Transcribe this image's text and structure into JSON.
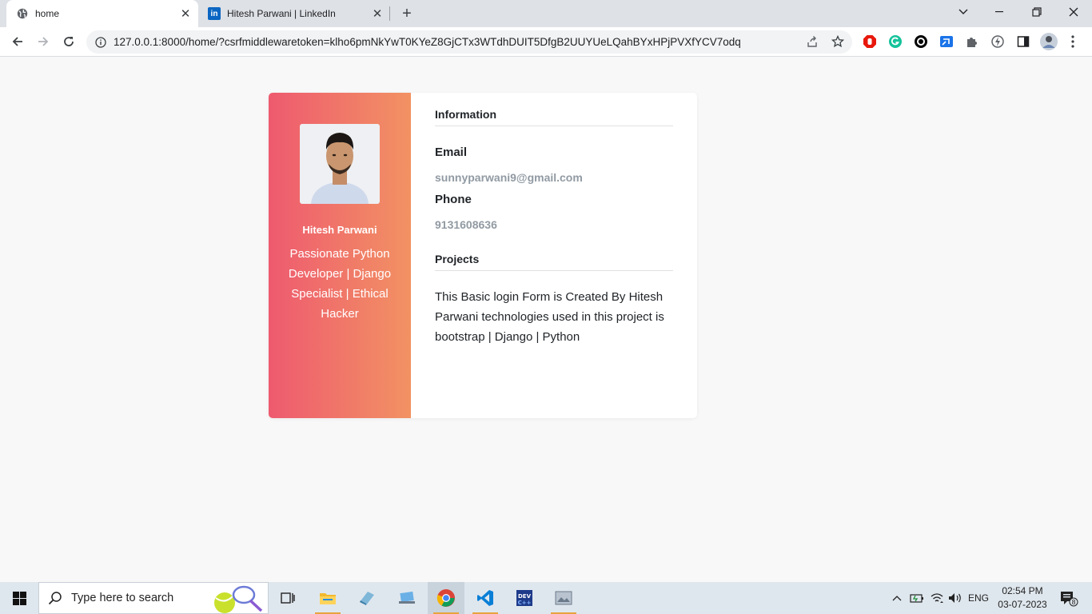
{
  "browser": {
    "tabs": [
      {
        "title": "home",
        "active": true,
        "icon": "globe-icon"
      },
      {
        "title": "Hitesh Parwani | LinkedIn",
        "active": false,
        "icon": "linkedin-icon"
      }
    ],
    "address": "127.0.0.1:8000/home/?csrfmiddlewaretoken=klho6pmNkYwT0KYeZ8GjCTx3WTdhDUIT5DfgB2UUYUeLQahBYxHPjPVXfYCV7odq",
    "extension_icons": [
      "adblock-icon",
      "grammarly-icon",
      "circle-extension-icon",
      "cast-extension-icon",
      "extensions-puzzle-icon",
      "performance-icon",
      "side-panel-icon",
      "profile-avatar"
    ]
  },
  "profile": {
    "name": "Hitesh Parwani",
    "bio": "Passionate Python Developer | Django Specialist | Ethical Hacker",
    "gradient_start": "#ee5a6f",
    "gradient_end": "#f29263"
  },
  "info": {
    "section_title": "Information",
    "email_label": "Email",
    "email": "sunnyparwani9@gmail.com",
    "phone_label": "Phone",
    "phone": "9131608636"
  },
  "projects": {
    "section_title": "Projects",
    "description": "This Basic login Form is Created By Hitesh Parwani technologies used in this project is bootstrap | Django | Python"
  },
  "taskbar": {
    "search_placeholder": "Type here to search",
    "apps": [
      "task-view-icon",
      "file-explorer-icon",
      "app-icon",
      "app-icon-2",
      "chrome-icon",
      "vscode-icon",
      "devcpp-icon",
      "photos-icon"
    ],
    "language": "ENG",
    "time": "02:54 PM",
    "date": "03-07-2023",
    "notification_count": "8"
  }
}
